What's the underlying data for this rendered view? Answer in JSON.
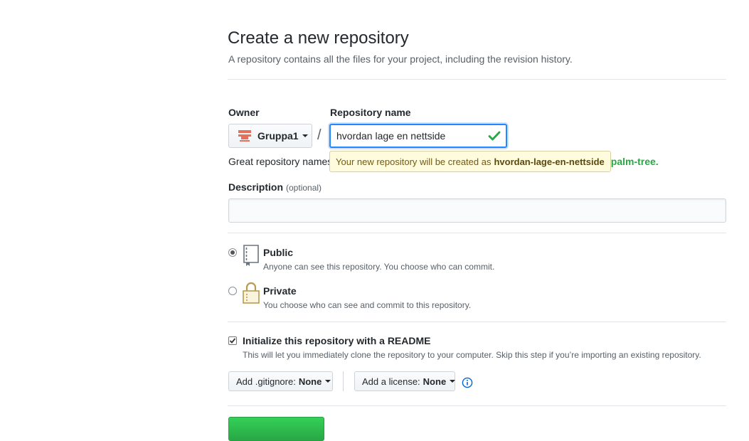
{
  "page": {
    "title": "Create a new repository",
    "subtitle": "A repository contains all the files for your project, including the revision history."
  },
  "owner": {
    "label": "Owner",
    "selected": "Gruppa1",
    "avatar_icon": "org-avatar-icon"
  },
  "separator": "/",
  "repo_name": {
    "label": "Repository name",
    "value": "hvordan lage en nettside",
    "status_icon": "check-icon",
    "status_color": "#28a745"
  },
  "name_hint": {
    "text": "Great repository names",
    "suggestion_tail": "ng-palm-tree."
  },
  "tooltip": {
    "text": "Your new repository will be created as",
    "slug": "hvordan-lage-en-nettside"
  },
  "description": {
    "label": "Description",
    "optional": "(optional)",
    "value": ""
  },
  "visibility": {
    "selected": "public",
    "options": [
      {
        "id": "public",
        "title": "Public",
        "desc": "Anyone can see this repository. You choose who can commit.",
        "icon": "repo-book-icon"
      },
      {
        "id": "private",
        "title": "Private",
        "desc": "You choose who can see and commit to this repository.",
        "icon": "lock-icon"
      }
    ]
  },
  "readme": {
    "checked": true,
    "label": "Initialize this repository with a README",
    "desc": "This will let you immediately clone the repository to your computer. Skip this step if you’re importing an existing repository."
  },
  "gitignore": {
    "prefix": "Add .gitignore:",
    "value": "None"
  },
  "license": {
    "prefix": "Add a license:",
    "value": "None"
  },
  "info_icon": "info-icon",
  "colors": {
    "accent": "#0366d6",
    "success": "#28a745",
    "tooltip_bg": "#fffbdd",
    "owner_avatar": "#e8705a"
  }
}
